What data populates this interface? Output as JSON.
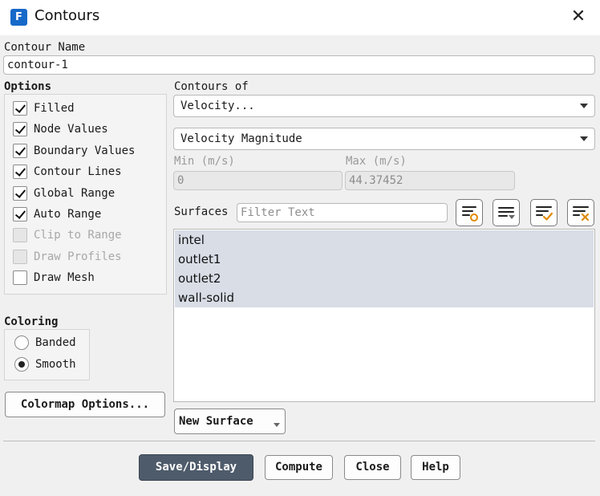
{
  "window": {
    "title": "Contours",
    "app_icon_letter": "F",
    "close_glyph": "✕"
  },
  "contour_name": {
    "label": "Contour Name",
    "value": "contour-1"
  },
  "options": {
    "label": "Options",
    "items": [
      {
        "label": "Filled",
        "checked": true,
        "enabled": true
      },
      {
        "label": "Node Values",
        "checked": true,
        "enabled": true
      },
      {
        "label": "Boundary Values",
        "checked": true,
        "enabled": true
      },
      {
        "label": "Contour Lines",
        "checked": true,
        "enabled": true
      },
      {
        "label": "Global Range",
        "checked": true,
        "enabled": true
      },
      {
        "label": "Auto Range",
        "checked": true,
        "enabled": true
      },
      {
        "label": "Clip to Range",
        "checked": false,
        "enabled": false
      },
      {
        "label": "Draw Profiles",
        "checked": false,
        "enabled": false
      },
      {
        "label": "Draw Mesh",
        "checked": false,
        "enabled": true
      }
    ]
  },
  "coloring": {
    "label": "Coloring",
    "items": [
      {
        "label": "Banded",
        "selected": false
      },
      {
        "label": "Smooth",
        "selected": true
      }
    ]
  },
  "colormap_button": "Colormap Options...",
  "contours_of": {
    "label": "Contours of",
    "primary": "Velocity...",
    "secondary": "Velocity Magnitude"
  },
  "range": {
    "min_label": "Min (m/s)",
    "min_value": "0",
    "max_label": "Max (m/s)",
    "max_value": "44.37452"
  },
  "surfaces": {
    "label": "Surfaces",
    "filter_placeholder": "Filter Text",
    "items": [
      "intel",
      "outlet1",
      "outlet2",
      "wall-solid"
    ],
    "tool_icons": [
      "select-all-icon",
      "filter-dropdown-icon",
      "check-list-icon",
      "clear-selection-icon"
    ]
  },
  "new_surface_button": "New Surface",
  "footer": {
    "save_display": "Save/Display",
    "compute": "Compute",
    "close": "Close",
    "help": "Help"
  },
  "colors": {
    "primary_button": "#4e5b6b",
    "selection": "#d8dde6",
    "app_icon": "#1769c9"
  }
}
